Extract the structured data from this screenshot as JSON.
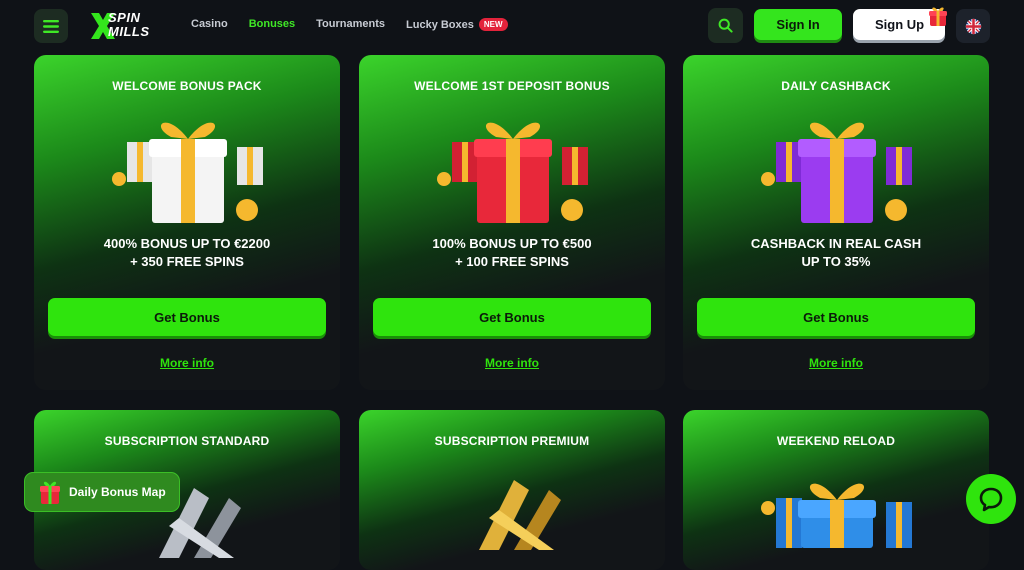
{
  "brand": {
    "name_line1": "SPIN",
    "name_line2": "MILLS",
    "accent": "#2fe40d"
  },
  "nav": [
    {
      "label": "Casino",
      "active": false
    },
    {
      "label": "Bonuses",
      "active": true
    },
    {
      "label": "Tournaments",
      "active": false
    },
    {
      "label": "Lucky Boxes",
      "active": false,
      "badge": "NEW"
    }
  ],
  "header": {
    "signin_label": "Sign In",
    "signup_label": "Sign Up",
    "language_icon": "uk-flag-icon"
  },
  "cards": [
    {
      "title": "WELCOME BONUS PACK",
      "desc_line1": "400% BONUS UP TO €2200",
      "desc_line2": "+ 350 FREE SPINS",
      "button": "Get Bonus",
      "more": "More info",
      "gift_color": "#f2f2f2"
    },
    {
      "title": "WELCOME 1ST DEPOSIT BONUS",
      "desc_line1": "100% BONUS UP TO €500",
      "desc_line2": "+ 100 FREE SPINS",
      "button": "Get Bonus",
      "more": "More info",
      "gift_color": "#e8283a"
    },
    {
      "title": "DAILY CASHBACK",
      "desc_line1": "CASHBACK IN REAL CASH",
      "desc_line2": "UP TO 35%",
      "button": "Get Bonus",
      "more": "More info",
      "gift_color": "#9b3cf0"
    },
    {
      "title": "SUBSCRIPTION STANDARD",
      "art": "silver-badge"
    },
    {
      "title": "SUBSCRIPTION PREMIUM",
      "art": "gold-badge"
    },
    {
      "title": "WEEKEND RELOAD",
      "gift_color": "#2f8ee8"
    }
  ],
  "floating": {
    "daily_map_label": "Daily Bonus Map",
    "chat_icon": "chat-bubble-icon"
  }
}
